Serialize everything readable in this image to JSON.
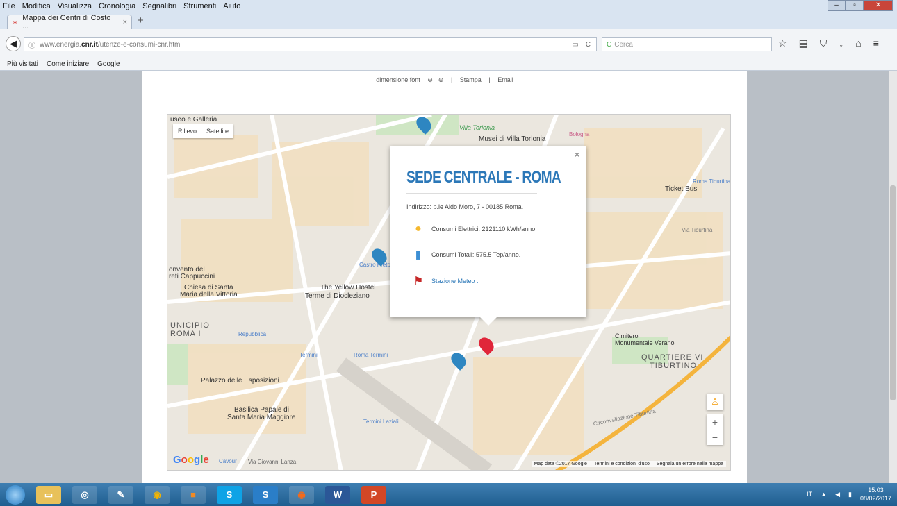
{
  "menubar": {
    "items": [
      "File",
      "Modifica",
      "Visualizza",
      "Cronologia",
      "Segnalibri",
      "Strumenti",
      "Aiuto"
    ]
  },
  "tab": {
    "title": "Mappa dei Centri di Costo ...",
    "close": "×",
    "new": "+"
  },
  "nav": {
    "url_prefix": "www.energia.",
    "url_domain": "cnr.it",
    "url_path": "/utenze-e-consumi-cnr.html",
    "search_placeholder": "Cerca"
  },
  "bookmarks": [
    "Più visitati",
    "Come iniziare",
    "Google"
  ],
  "pagebar": {
    "font_label": "dimensione font",
    "print": "Stampa",
    "email": "Email"
  },
  "map": {
    "maptype": [
      "Rilievo",
      "Satellite"
    ],
    "labels": [
      {
        "text": "useo e Galleria",
        "x": "l"
      },
      {
        "text": "Musei di Villa Torlonia"
      },
      {
        "text": "Villa Torlonia"
      },
      {
        "text": "Ticket Bus"
      },
      {
        "text": "Via Tiburtina"
      },
      {
        "text": "onvento del"
      },
      {
        "text": "reti Cappuccini"
      },
      {
        "text": "Chiesa di Santa"
      },
      {
        "text": "Maria della Vittoria"
      },
      {
        "text": "The Yellow Hostel"
      },
      {
        "text": "Terme di Diocleziano"
      },
      {
        "text": "UNICIPIO"
      },
      {
        "text": "ROMA I"
      },
      {
        "text": "Palazzo delle Esposizioni"
      },
      {
        "text": "Basilica Papale di"
      },
      {
        "text": "Santa Maria Maggiore"
      },
      {
        "text": "Cimitero"
      },
      {
        "text": "Monumentale Verano"
      },
      {
        "text": "QUARTIERE VI"
      },
      {
        "text": "TIBURTINO"
      },
      {
        "text": "Circonvallazione Tiburtina"
      },
      {
        "text": "Repubblica"
      },
      {
        "text": "Termini"
      },
      {
        "text": "Roma Termini"
      },
      {
        "text": "Termini Laziali"
      },
      {
        "text": "Castro Pretorio"
      },
      {
        "text": "Bologna"
      },
      {
        "text": "Roma Tiburtina"
      }
    ],
    "popup": {
      "title": "SEDE CENTRALE - ROMA",
      "close": "×",
      "address": "Indirizzo: p.le Aldo Moro, 7 - 00185 Roma.",
      "electric": "Consumi Elettrici: 2121110 kWh/anno.",
      "total": "Consumi Totali: 575.5 Tep/anno.",
      "meteo": "Stazione Meteo ."
    },
    "footer": {
      "data": "Map data ©2017 Google",
      "terms": "Termini e condizioni d'uso",
      "report": "Segnala un errore nella mappa",
      "street": "Via Giovanni Lanza",
      "cavour": "Cavour"
    },
    "zoom": {
      "in": "+",
      "out": "−"
    }
  },
  "taskbar": {
    "apps": [
      "",
      "",
      "",
      "",
      "",
      "",
      "S",
      "S",
      "",
      "W",
      "P"
    ],
    "lang": "IT",
    "time": "15:03",
    "date": "08/02/2017"
  },
  "colors": {
    "accent": "#2c78b8",
    "marker_red": "#e0263a",
    "marker_blue": "#2e86c1"
  }
}
